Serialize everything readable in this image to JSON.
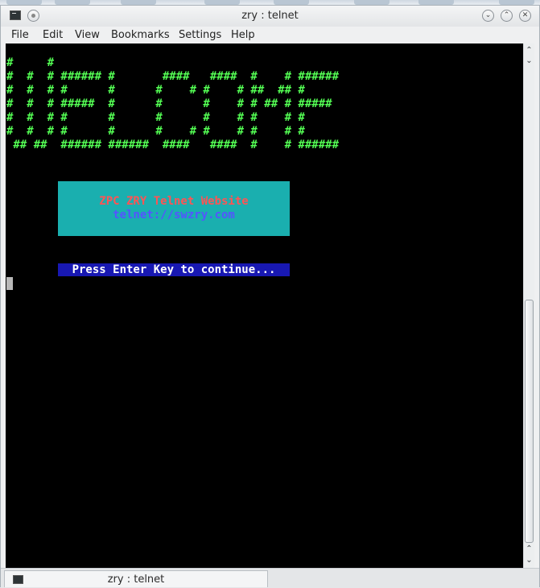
{
  "window": {
    "title": "zry : telnet"
  },
  "menubar": {
    "items": [
      "File",
      "Edit",
      "View",
      "Bookmarks",
      "Settings",
      "Help"
    ]
  },
  "terminal": {
    "banner": "#     #\n#  #  # ###### #       ####   ####  #    # ######\n#  #  # #      #      #    # #    # ##  ## #\n#  #  # #####  #      #      #    # # ## # #####\n#  #  # #      #      #      #    # #    # #\n#  #  # #      #      #    # #    # #    # #\n ## ##  ###### ######  ####   ####  #    # ######",
    "info_line1": "ZPC ZRY Telnet Website",
    "info_line2": "telnet://swzry.com",
    "prompt": "Press Enter Key to continue...",
    "colors": {
      "background": "#000000",
      "banner": "#54ff54",
      "info_box": "#1aafaf",
      "info_line1": "#ff5454",
      "info_line2": "#5454ff",
      "prompt_bg": "#1818b2"
    }
  },
  "scrollbar": {
    "up_icon": "chevron-up-icon",
    "down_icon": "chevron-down-icon"
  },
  "tabbar": {
    "tab_label": "zry : telnet"
  }
}
